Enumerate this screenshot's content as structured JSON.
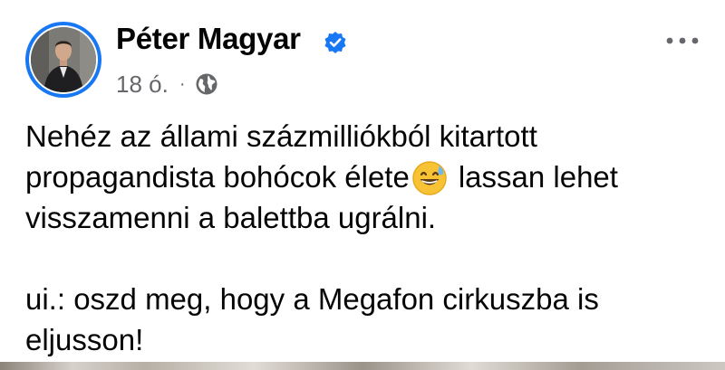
{
  "post": {
    "author": {
      "name": "Péter Magyar",
      "verified": true,
      "avatar": "avatar"
    },
    "meta": {
      "time": "18 ó.",
      "separator": "·",
      "audience_icon": "globe-icon"
    },
    "menu_icon": "more-options-icon",
    "body": {
      "line1": "Nehéz az állami százmilliókból kitartott",
      "line2_before": "propagandista bohócok élete",
      "line2_emoji": "grinning-face-with-sweat-emoji",
      "line2_after": "lassan lehet",
      "line3": "visszamenni a balettba ugrálni.",
      "line4": "ui.: oszd meg, hogy a Megafon cirkuszba is",
      "line5": "eljusson!"
    }
  },
  "colors": {
    "accent": "#1877f2",
    "text": "#050505",
    "secondary_text": "#65676b"
  }
}
